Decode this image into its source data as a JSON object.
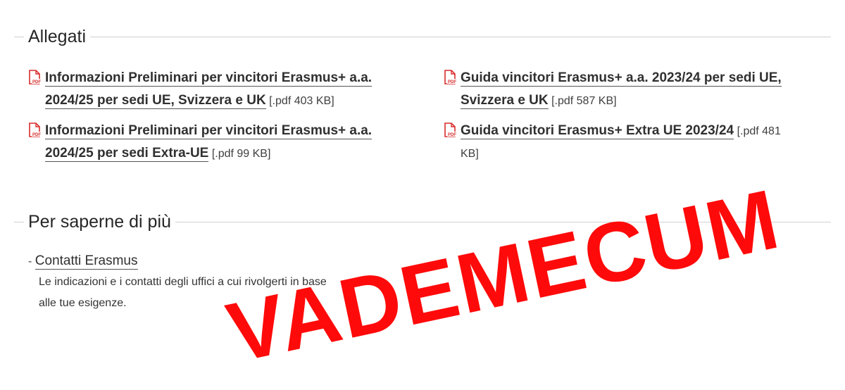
{
  "allegati": {
    "title": "Allegati",
    "items": [
      {
        "icon": "pdf-icon",
        "line1": "Informazioni Preliminari per vincitori Erasmus+ a.a.",
        "line2": "2024/25 per sedi UE, Svizzera e UK",
        "meta": "[.pdf 403 KB]"
      },
      {
        "icon": "pdf-icon",
        "line1": "Guida vincitori Erasmus+ a.a. 2023/24 per sedi UE,",
        "line2": "Svizzera e UK",
        "meta": "[.pdf 587 KB]"
      },
      {
        "icon": "pdf-icon",
        "line1": "Informazioni Preliminari per vincitori Erasmus+ a.a.",
        "line2": "2024/25 per sedi Extra-UE",
        "meta": "[.pdf 99 KB]"
      },
      {
        "icon": "pdf-icon",
        "line1": "Guida vincitori Erasmus+ Extra UE 2023/24",
        "meta_part1": "[.pdf 481",
        "meta_part2": "KB]"
      }
    ]
  },
  "saperne": {
    "title": "Per saperne di più",
    "dash": "-",
    "link": "Contatti Erasmus",
    "description_line1": "Le indicazioni e i contatti degli uffici a cui rivolgerti in base",
    "description_line2": "alle tue esigenze."
  },
  "stamp": {
    "text": "VADEMECUM",
    "color": "#ff0a0a"
  }
}
